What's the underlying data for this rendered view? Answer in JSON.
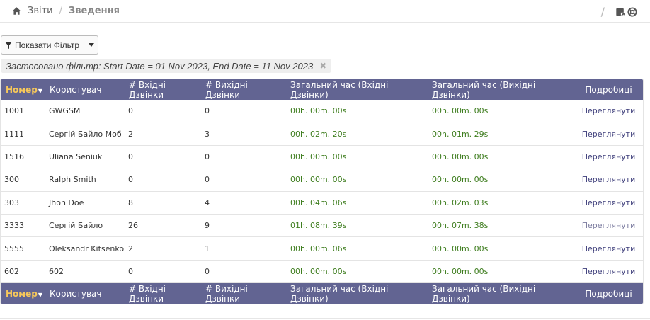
{
  "breadcrumb": {
    "home": "Звіти",
    "separator": "/",
    "current": "Зведення"
  },
  "topbar": {
    "separator": "/",
    "icons": [
      "export-icon",
      "help-icon"
    ]
  },
  "filter": {
    "button_label": "Показати Фільтр",
    "applied_text": "Застосовано фільтр: Start Date = 01 Nov 2023, End Date = 11 Nov 2023",
    "remove_glyph": "✖"
  },
  "table": {
    "headers": [
      "Номер",
      "Користувач",
      "# Вхідні Дзвінки",
      "# Вихідні Дзвінки",
      "Загальний час (Вхідні Дзвінки)",
      "Загальний час (Вихідні Дзвінки)",
      "Подробиці"
    ],
    "rows": [
      [
        "1001",
        "GWGSM",
        "0",
        "0",
        "00h. 00m. 00s",
        "00h. 00m. 00s",
        "Переглянути"
      ],
      [
        "1111",
        "Сергій Байло Моб",
        "2",
        "3",
        "00h. 02m. 20s",
        "00h. 01m. 29s",
        "Переглянути"
      ],
      [
        "1516",
        "Uliana Seniuk",
        "0",
        "0",
        "00h. 00m. 00s",
        "00h. 00m. 00s",
        "Переглянути"
      ],
      [
        "300",
        "Ralph Smith",
        "0",
        "0",
        "00h. 00m. 00s",
        "00h. 00m. 00s",
        "Переглянути"
      ],
      [
        "303",
        "Jhon Doe",
        "8",
        "4",
        "00h. 04m. 06s",
        "00h. 02m. 03s",
        "Переглянути"
      ],
      [
        "3333",
        "Сергій Байло",
        "26",
        "9",
        "01h. 08m. 39s",
        "00h. 07m. 38s",
        "Переглянути"
      ],
      [
        "5555",
        "Oleksandr Kitsenko",
        "2",
        "1",
        "00h. 00m. 06s",
        "00h. 00m. 00s",
        "Переглянути"
      ],
      [
        "602",
        "602",
        "0",
        "0",
        "00h. 00m. 00s",
        "00h. 00m. 00s",
        "Переглянути"
      ]
    ]
  },
  "colors": {
    "header_bg": "#626492",
    "sort_header": "#f7c85a",
    "time_text": "#3e7d1e",
    "link_text": "#3d3d7a"
  }
}
